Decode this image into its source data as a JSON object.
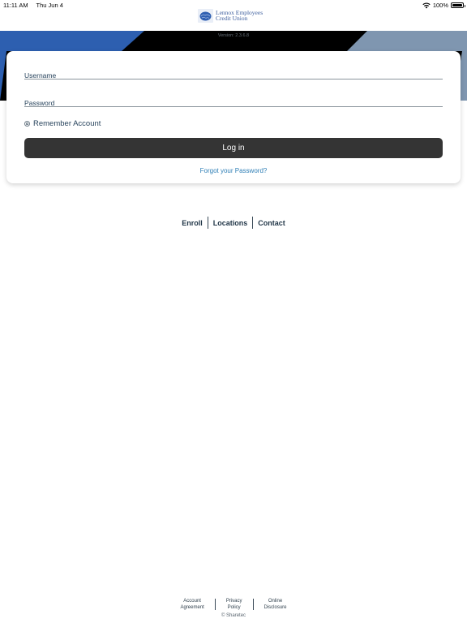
{
  "status_bar": {
    "time": "11:11 AM",
    "date": "Thu Jun 4",
    "battery": "100%",
    "battery_level": 1.0
  },
  "header": {
    "logo_line1": "Lennox Employees",
    "logo_line2": "Credit Union",
    "version": "Version: 2.3.6.8"
  },
  "colors": {
    "banner_blue": "#2d5fb0",
    "banner_black": "#000000",
    "banner_steel": "#7f96b0",
    "button_dark": "#343434",
    "link_blue": "#2f7fb6"
  },
  "login": {
    "username_placeholder": "Username",
    "password_placeholder": "Password",
    "remember_label": "Remember Account",
    "login_label": "Log in",
    "forgot_label": "Forgot your Password?"
  },
  "links": {
    "enroll": "Enroll",
    "locations": "Locations",
    "contact": "Contact"
  },
  "footer": {
    "account_agreement": "Account\nAgreement",
    "privacy_policy": "Privacy\nPolicy",
    "online_disclosure": "Online\nDisclosure",
    "copyright": "© Sharetec"
  }
}
